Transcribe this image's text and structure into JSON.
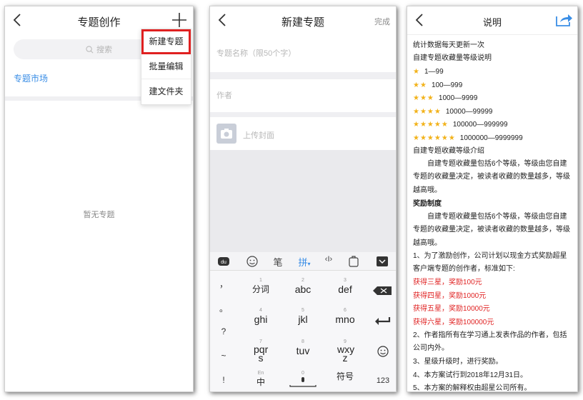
{
  "panel1": {
    "title": "专题创作",
    "search_placeholder": "搜索",
    "market_link": "专题市场",
    "empty_text": "暂无专题",
    "menu": [
      "新建专题",
      "批量编辑",
      "建文件夹"
    ]
  },
  "panel2": {
    "title": "新建专题",
    "done": "完成",
    "name_placeholder": "专题名称（限50个字）",
    "author_placeholder": "作者",
    "cover_label": "上传封面",
    "toolbar": {
      "pen": "笔",
      "pinyin": "拼",
      "cursor": "‹I›"
    },
    "keys": [
      {
        "num": "1",
        "label": "分词"
      },
      {
        "num": "2",
        "label": "abc"
      },
      {
        "num": "3",
        "label": "def"
      },
      {
        "num": "4",
        "label": "ghi"
      },
      {
        "num": "5",
        "label": "jkl"
      },
      {
        "num": "6",
        "label": "mno"
      },
      {
        "num": "7",
        "label": "pqr s"
      },
      {
        "num": "8",
        "label": "tuv"
      },
      {
        "num": "9",
        "label": "wxy z"
      },
      {
        "num": "En",
        "label": "中"
      },
      {
        "num": "0",
        "label": ""
      },
      {
        "num": "",
        "label": "符号"
      }
    ],
    "left_keys": [
      "，",
      "。",
      "?",
      "~",
      "!"
    ],
    "num_key": "123"
  },
  "panel3": {
    "title": "说明",
    "line1": "统计数据每天更新一次",
    "line2": "自建专题收藏量等级说明",
    "levels": [
      {
        "stars": "★",
        "range": "1—99"
      },
      {
        "stars": "★★",
        "range": "100—999"
      },
      {
        "stars": "★★★",
        "range": "1000—9999"
      },
      {
        "stars": "★★★★",
        "range": "10000—99999"
      },
      {
        "stars": "★★★★★",
        "range": "100000—999999"
      },
      {
        "stars": "★★★★★★",
        "range": "1000000—9999999"
      }
    ],
    "intro_title": "自建专题收藏等级介绍",
    "intro_para": "自建专题收藏量包括6个等级，等级由您自建专题的收藏量决定，被读者收藏的数量越多，等级越高哦。",
    "reward_title": "奖励制度",
    "reward_para": "自建专题收藏量包括6个等级，等级由您自建专题的收藏量决定，被读者收藏的数量越多，等级越高哦。",
    "rule1": "1、为了激励创作，公司计划以现金方式奖励超星客户端专题的创作者，标准如下:",
    "rewards": [
      "获得三星，奖励100元",
      "获得四星，奖励1000元",
      "获得五星，奖励10000元",
      "获得六星，奖励100000元"
    ],
    "rule2": "2、作者指所有在学习通上发表作品的作者，包括公司内外。",
    "rule3": "3、星级升级时，进行奖励。",
    "rule4": "4、本方案试行到2018年12月31日。",
    "rule5": "5、本方案的解释权由超星公司所有。"
  },
  "colors": {
    "accent_blue": "#3a8ee6",
    "highlight_red": "#e02020",
    "star_gold": "#f2b21a",
    "reward_red": "#e02424"
  }
}
